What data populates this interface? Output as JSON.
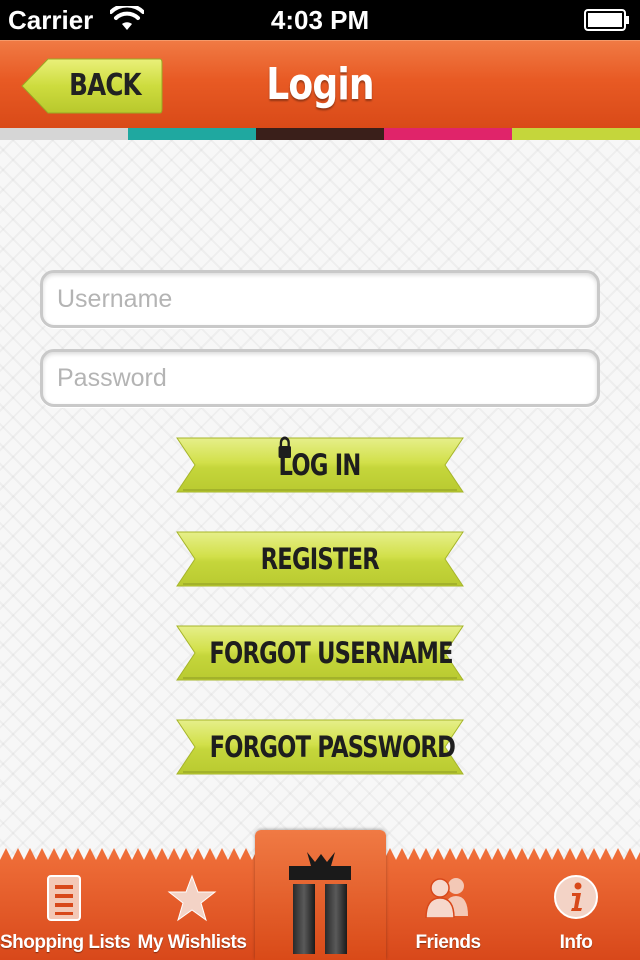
{
  "status_bar": {
    "carrier": "Carrier",
    "time": "4:03 PM"
  },
  "nav": {
    "back_label": "BACK",
    "title": "Login"
  },
  "stripe_colors": [
    "#d6d6d6",
    "#1fa8a0",
    "#3a1f1a",
    "#e0246a",
    "#c5d63b"
  ],
  "form": {
    "username_placeholder": "Username",
    "password_placeholder": "Password"
  },
  "buttons": {
    "login": "LOG IN",
    "register": "REGISTER",
    "forgot_username": "FORGOT USERNAME",
    "forgot_password": "FORGOT PASSWORD"
  },
  "tabs": [
    {
      "label": "Shopping Lists",
      "icon": "list-icon"
    },
    {
      "label": "My Wishlists",
      "icon": "star-icon"
    },
    {
      "label": "",
      "icon": "gift-icon"
    },
    {
      "label": "Friends",
      "icon": "friends-icon"
    },
    {
      "label": "Info",
      "icon": "info-icon"
    }
  ],
  "colors": {
    "accent": "#e85a24",
    "ribbon": "#c5d63b"
  }
}
